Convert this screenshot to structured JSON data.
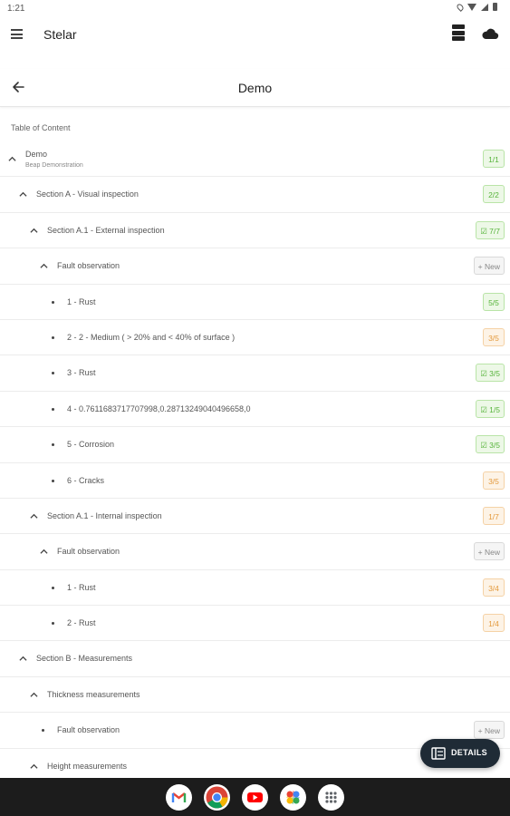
{
  "status_bar": {
    "time": "1:21"
  },
  "app_bar": {
    "title": "Stelar"
  },
  "page": {
    "title": "Demo"
  },
  "toc_label": "Table of Content",
  "rows": [
    {
      "kind": "chevron",
      "indent": 0,
      "label": "Demo",
      "sublabel": "Beap Demonstration",
      "badge": "1/1",
      "badge_color": "green"
    },
    {
      "kind": "chevron",
      "indent": 1,
      "label": "Section A - Visual inspection",
      "badge": "2/2",
      "badge_color": "green"
    },
    {
      "kind": "chevron",
      "indent": 2,
      "label": "Section A.1 - External inspection",
      "badge": "☑ 7/7",
      "badge_color": "green"
    },
    {
      "kind": "chevron",
      "indent": 3,
      "label": "Fault observation",
      "badge": "+ New",
      "badge_color": "gray"
    },
    {
      "kind": "bullet",
      "indent": 4,
      "label": "1 - Rust",
      "badge": "5/5",
      "badge_color": "green"
    },
    {
      "kind": "bullet",
      "indent": 4,
      "label": "2 - 2 - Medium ( > 20% and < 40% of surface )",
      "badge": "3/5",
      "badge_color": "orange"
    },
    {
      "kind": "bullet",
      "indent": 4,
      "label": "3 - Rust",
      "badge": "☑ 3/5",
      "badge_color": "green"
    },
    {
      "kind": "bullet",
      "indent": 4,
      "label": "4 - 0.7611683717707998,0.28713249040496658,0",
      "badge": "☑ 1/5",
      "badge_color": "green"
    },
    {
      "kind": "bullet",
      "indent": 4,
      "label": "5 - Corrosion",
      "badge": "☑ 3/5",
      "badge_color": "green"
    },
    {
      "kind": "bullet",
      "indent": 4,
      "label": "6 - Cracks",
      "badge": "3/5",
      "badge_color": "orange"
    },
    {
      "kind": "chevron",
      "indent": 2,
      "label": "Section A.1 - Internal inspection",
      "badge": "1/7",
      "badge_color": "orange"
    },
    {
      "kind": "chevron",
      "indent": 3,
      "label": "Fault observation",
      "badge": "+ New",
      "badge_color": "gray"
    },
    {
      "kind": "bullet",
      "indent": 4,
      "label": "1 - Rust",
      "badge": "3/4",
      "badge_color": "orange"
    },
    {
      "kind": "bullet",
      "indent": 4,
      "label": "2 - Rust",
      "badge": "1/4",
      "badge_color": "orange"
    },
    {
      "kind": "chevron",
      "indent": 1,
      "label": "Section B - Measurements",
      "badge": "",
      "badge_color": ""
    },
    {
      "kind": "chevron",
      "indent": 2,
      "label": "Thickness measurements",
      "badge": "",
      "badge_color": ""
    },
    {
      "kind": "bullet",
      "indent": 3,
      "label": "Fault observation",
      "badge": "+ New",
      "badge_color": "gray"
    },
    {
      "kind": "chevron",
      "indent": 2,
      "label": "Height measurements",
      "badge": "",
      "badge_color": ""
    }
  ],
  "fab": {
    "label": "DETAILS"
  },
  "dock": {
    "apps": [
      {
        "icon": "gmail-icon"
      },
      {
        "icon": "chrome-icon"
      },
      {
        "icon": "youtube-icon"
      },
      {
        "icon": "photos-icon"
      },
      {
        "icon": "app-drawer-icon"
      }
    ]
  },
  "colors": {
    "badge_green": "#57b43b",
    "badge_orange": "#e49a3d",
    "fab_background": "#1f2b36",
    "dock_background": "#1c1c1c"
  }
}
